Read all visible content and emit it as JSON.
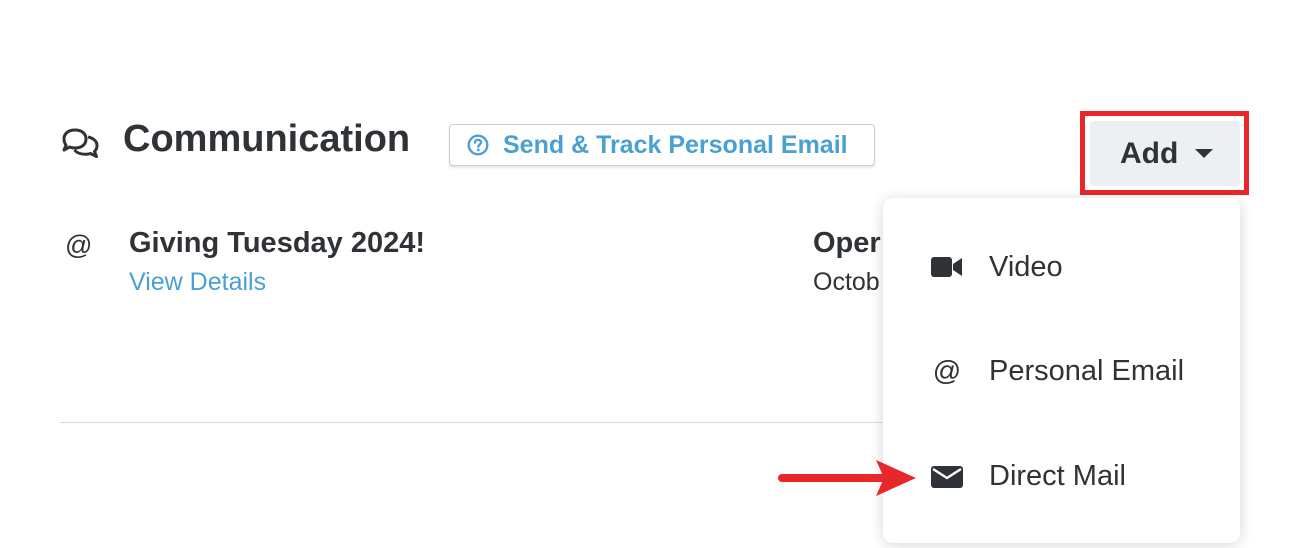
{
  "section": {
    "icon": "comments-icon",
    "title": "Communication",
    "help_link": {
      "icon": "question-circle-icon",
      "label": "Send & Track Personal Email"
    },
    "add_button": {
      "label": "Add",
      "icon": "caret-down-icon"
    }
  },
  "communications": [
    {
      "type_icon": "at-icon",
      "type_glyph": "@",
      "title": "Giving Tuesday 2024!",
      "link_label": "View Details",
      "status": "Oper",
      "date": "Octob"
    }
  ],
  "add_menu": {
    "items": [
      {
        "icon": "video-camera-icon",
        "label": "Video"
      },
      {
        "icon": "at-icon",
        "glyph": "@",
        "label": "Personal Email"
      },
      {
        "icon": "envelope-icon",
        "label": "Direct Mail"
      }
    ]
  },
  "colors": {
    "text": "#2f3337",
    "link": "#4aa0d3",
    "highlight": "#e8272a",
    "button_bg": "#edf0f3"
  }
}
